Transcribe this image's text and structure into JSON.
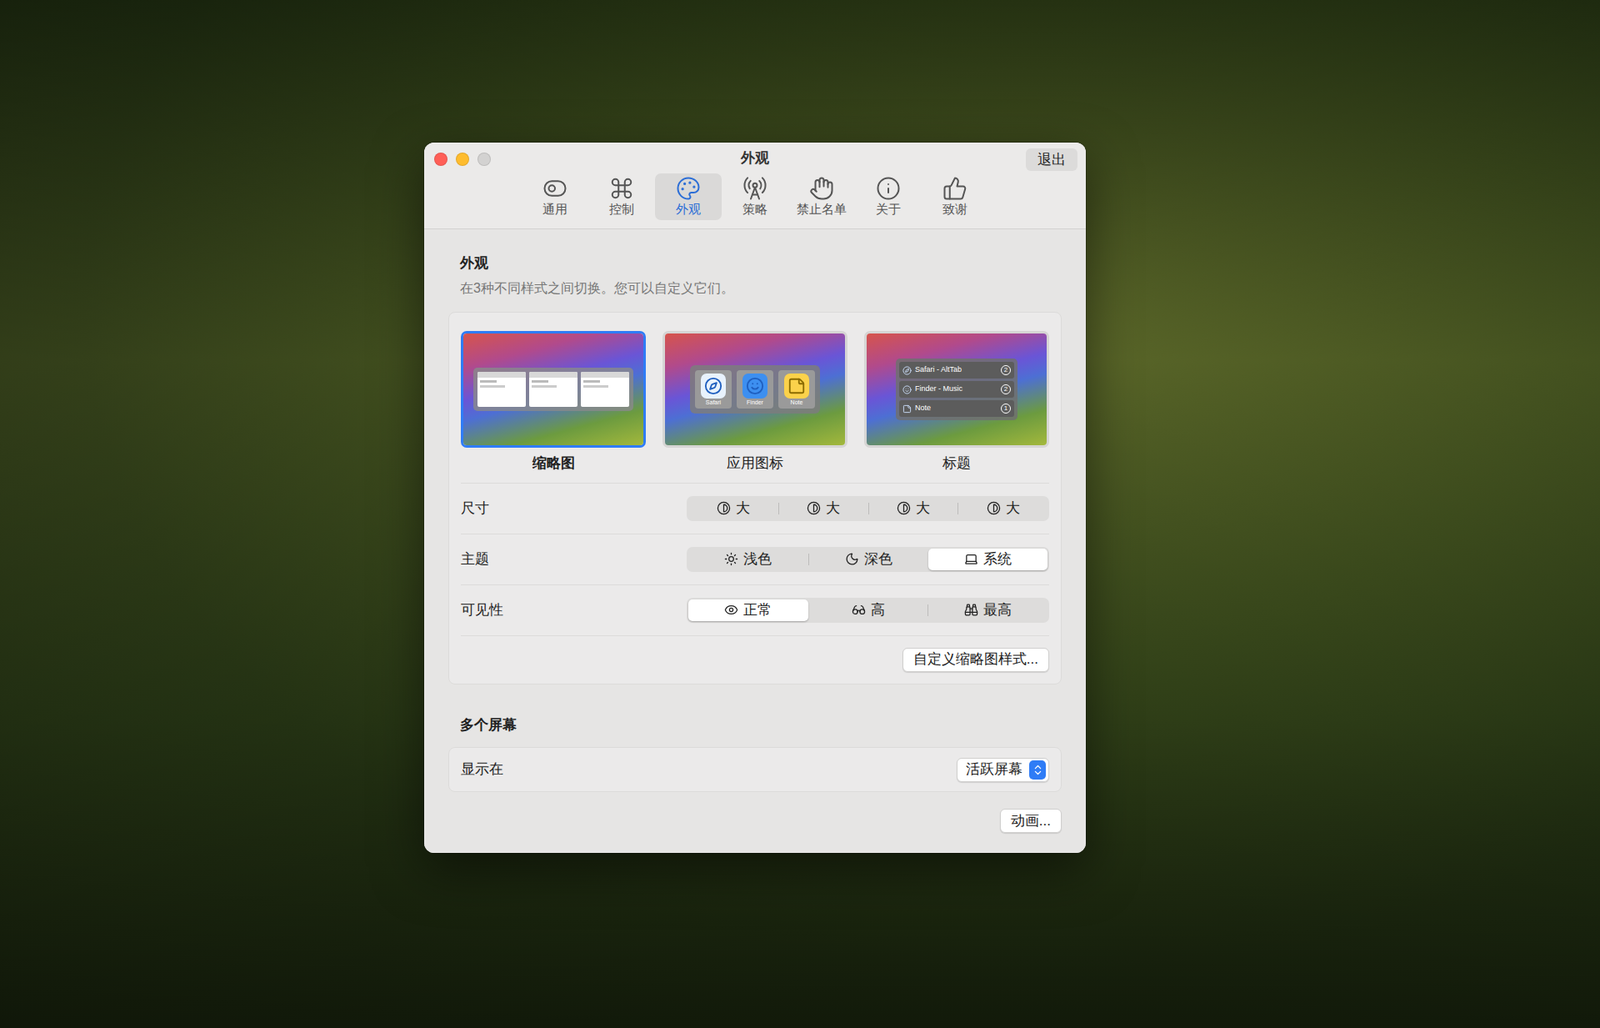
{
  "window": {
    "title": "外观",
    "quit_button": "退出",
    "traffic_lights": [
      {
        "name": "close",
        "disabled": false,
        "color": "#ff5f57"
      },
      {
        "name": "minimize",
        "disabled": false,
        "color": "#febc2e"
      },
      {
        "name": "zoom",
        "disabled": true,
        "color": "#d3d2d1"
      }
    ]
  },
  "tabs": [
    {
      "label": "通用",
      "selected": false
    },
    {
      "label": "控制",
      "selected": false
    },
    {
      "label": "外观",
      "selected": true
    },
    {
      "label": "策略",
      "selected": false
    },
    {
      "label": "禁止名单",
      "selected": false
    },
    {
      "label": "关于",
      "selected": false
    },
    {
      "label": "致谢",
      "selected": false
    }
  ],
  "appearance": {
    "heading": "外观",
    "description": "在3种不同样式之间切换。您可以自定义它们。",
    "styles": [
      {
        "label": "缩略图",
        "selected": true,
        "kind": "thumbnails"
      },
      {
        "label": "应用图标",
        "selected": false,
        "kind": "icons",
        "apps": [
          "Safari",
          "Finder",
          "Note"
        ]
      },
      {
        "label": "标题",
        "selected": false,
        "kind": "titles",
        "rows": [
          {
            "title": "Safari - AltTab",
            "count": "2"
          },
          {
            "title": "Finder - Music",
            "count": "2"
          },
          {
            "title": "Note",
            "count": "1"
          }
        ]
      }
    ],
    "rows": [
      {
        "label": "尺寸",
        "kind": "size",
        "options": [
          {
            "label": "大",
            "selected": false
          },
          {
            "label": "大",
            "selected": false
          },
          {
            "label": "大",
            "selected": false
          },
          {
            "label": "大",
            "selected": false
          }
        ]
      },
      {
        "label": "主题",
        "kind": "theme",
        "options": [
          {
            "label": "浅色",
            "selected": false
          },
          {
            "label": "深色",
            "selected": false
          },
          {
            "label": "系统",
            "selected": true
          }
        ]
      },
      {
        "label": "可见性",
        "kind": "visibility",
        "options": [
          {
            "label": "正常",
            "selected": true
          },
          {
            "label": "高",
            "selected": false
          },
          {
            "label": "最高",
            "selected": false
          }
        ]
      }
    ],
    "customize_button": "自定义缩略图样式..."
  },
  "multiple_screens": {
    "heading": "多个屏幕",
    "label": "显示在",
    "value": "活跃屏幕"
  },
  "animation_button": "动画..."
}
